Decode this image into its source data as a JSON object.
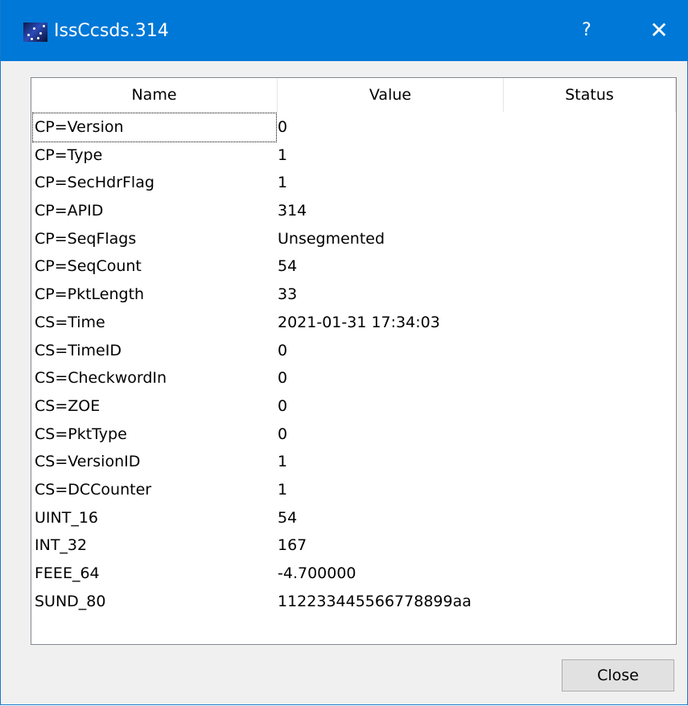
{
  "window": {
    "title": "IssCcsds.314",
    "help_glyph": "?",
    "close_glyph": "✕",
    "icon": "app-icon",
    "accent": "#0078d7"
  },
  "table": {
    "headers": {
      "name": "Name",
      "value": "Value",
      "status": "Status"
    },
    "rows": [
      {
        "name": "CP=Version",
        "value": "0",
        "status": ""
      },
      {
        "name": "CP=Type",
        "value": "1",
        "status": ""
      },
      {
        "name": "CP=SecHdrFlag",
        "value": "1",
        "status": ""
      },
      {
        "name": "CP=APID",
        "value": "314",
        "status": ""
      },
      {
        "name": "CP=SeqFlags",
        "value": "Unsegmented",
        "status": ""
      },
      {
        "name": "CP=SeqCount",
        "value": "54",
        "status": ""
      },
      {
        "name": "CP=PktLength",
        "value": "33",
        "status": ""
      },
      {
        "name": "CS=Time",
        "value": "2021-01-31 17:34:03",
        "status": ""
      },
      {
        "name": "CS=TimeID",
        "value": "0",
        "status": ""
      },
      {
        "name": "CS=CheckwordIn",
        "value": "0",
        "status": ""
      },
      {
        "name": "CS=ZOE",
        "value": "0",
        "status": ""
      },
      {
        "name": "CS=PktType",
        "value": "0",
        "status": ""
      },
      {
        "name": "CS=VersionID",
        "value": "1",
        "status": ""
      },
      {
        "name": "CS=DCCounter",
        "value": "1",
        "status": ""
      },
      {
        "name": "UINT_16",
        "value": "54",
        "status": ""
      },
      {
        "name": "INT_32",
        "value": "167",
        "status": ""
      },
      {
        "name": "FEEE_64",
        "value": "-4.700000",
        "status": ""
      },
      {
        "name": "SUND_80",
        "value": "112233445566778899aa",
        "status": ""
      }
    ]
  },
  "footer": {
    "close_label": "Close"
  }
}
